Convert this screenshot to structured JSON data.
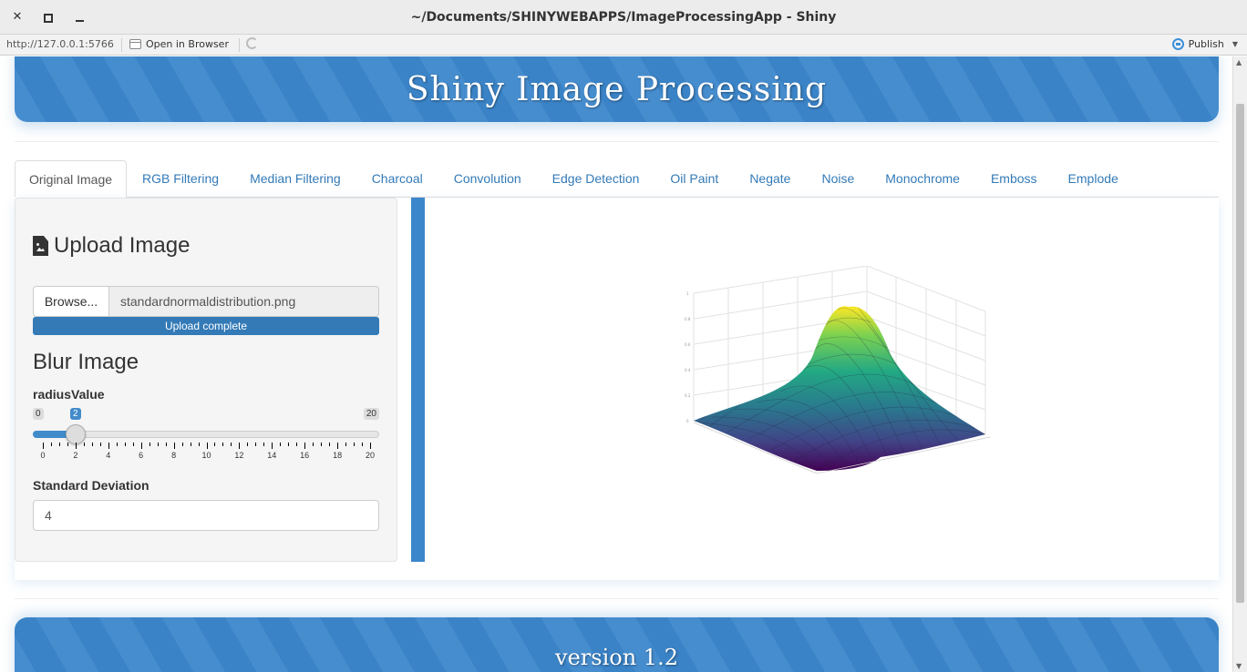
{
  "window": {
    "title": "~/Documents/SHINYWEBAPPS/ImageProcessingApp - Shiny"
  },
  "toolbar": {
    "url": "http://127.0.0.1:5766",
    "open_in_browser": "Open in Browser",
    "publish": "Publish"
  },
  "app": {
    "title": "Shiny Image Processing",
    "footer": "version 1.2"
  },
  "tabs": [
    {
      "label": "Original Image",
      "active": true
    },
    {
      "label": "RGB Filtering"
    },
    {
      "label": "Median Filtering"
    },
    {
      "label": "Charcoal"
    },
    {
      "label": "Convolution"
    },
    {
      "label": "Edge Detection"
    },
    {
      "label": "Oil Paint"
    },
    {
      "label": "Negate"
    },
    {
      "label": "Noise"
    },
    {
      "label": "Monochrome"
    },
    {
      "label": "Emboss"
    },
    {
      "label": "Emplode"
    }
  ],
  "sidebar": {
    "upload_heading": "Upload Image",
    "browse_label": "Browse...",
    "file_name": "standardnormaldistribution.png",
    "upload_status": "Upload complete",
    "blur_heading": "Blur Image",
    "radius_label": "radiusValue",
    "radius": {
      "min": "0",
      "max": "20",
      "value": "2",
      "ticks": [
        "0",
        "2",
        "4",
        "6",
        "8",
        "10",
        "12",
        "14",
        "16",
        "18",
        "20"
      ]
    },
    "sd_label": "Standard Deviation",
    "sd_value": "4"
  },
  "colors": {
    "accent": "#3c87cc",
    "link": "#337ab7",
    "progress": "#337ab7"
  }
}
